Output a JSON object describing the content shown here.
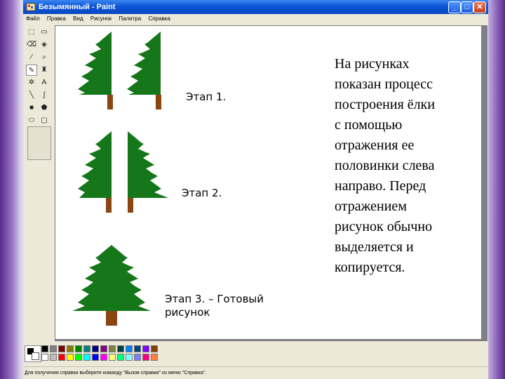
{
  "window": {
    "title": "Безымянный - Paint",
    "buttons": [
      "_",
      "□",
      "✕"
    ]
  },
  "menu": [
    "Файл",
    "Правка",
    "Вид",
    "Рисунок",
    "Палитра",
    "Справка"
  ],
  "canvas": {
    "stage1": "Этап 1.",
    "stage2": "Этап 2.",
    "stage3_line1": "Этап 3. – Готовый",
    "stage3_line2": "рисунок",
    "description": [
      "На рисунках",
      "показан процесс",
      "построения ёлки",
      "с помощью",
      "отражения ее",
      "половинки слева",
      "направо. Перед",
      "отражением",
      "рисунок обычно",
      "выделяется и",
      "копируется."
    ]
  },
  "palette": {
    "colors_top": [
      "#000000",
      "#808080",
      "#800000",
      "#808000",
      "#008000",
      "#008080",
      "#000080",
      "#800080",
      "#808040",
      "#004040",
      "#0080ff",
      "#004080",
      "#8000ff",
      "#804000"
    ],
    "colors_bottom": [
      "#ffffff",
      "#c0c0c0",
      "#ff0000",
      "#ffff00",
      "#00ff00",
      "#00ffff",
      "#0000ff",
      "#ff00ff",
      "#ffff80",
      "#00ff80",
      "#80ffff",
      "#8080ff",
      "#ff0080",
      "#ff8040"
    ]
  },
  "status": "Для получения справки выберите команду \"Вызов справки\" из меню \"Справка\".",
  "colors": {
    "tree_green": "#15761a",
    "trunk_brown": "#8b4513"
  }
}
